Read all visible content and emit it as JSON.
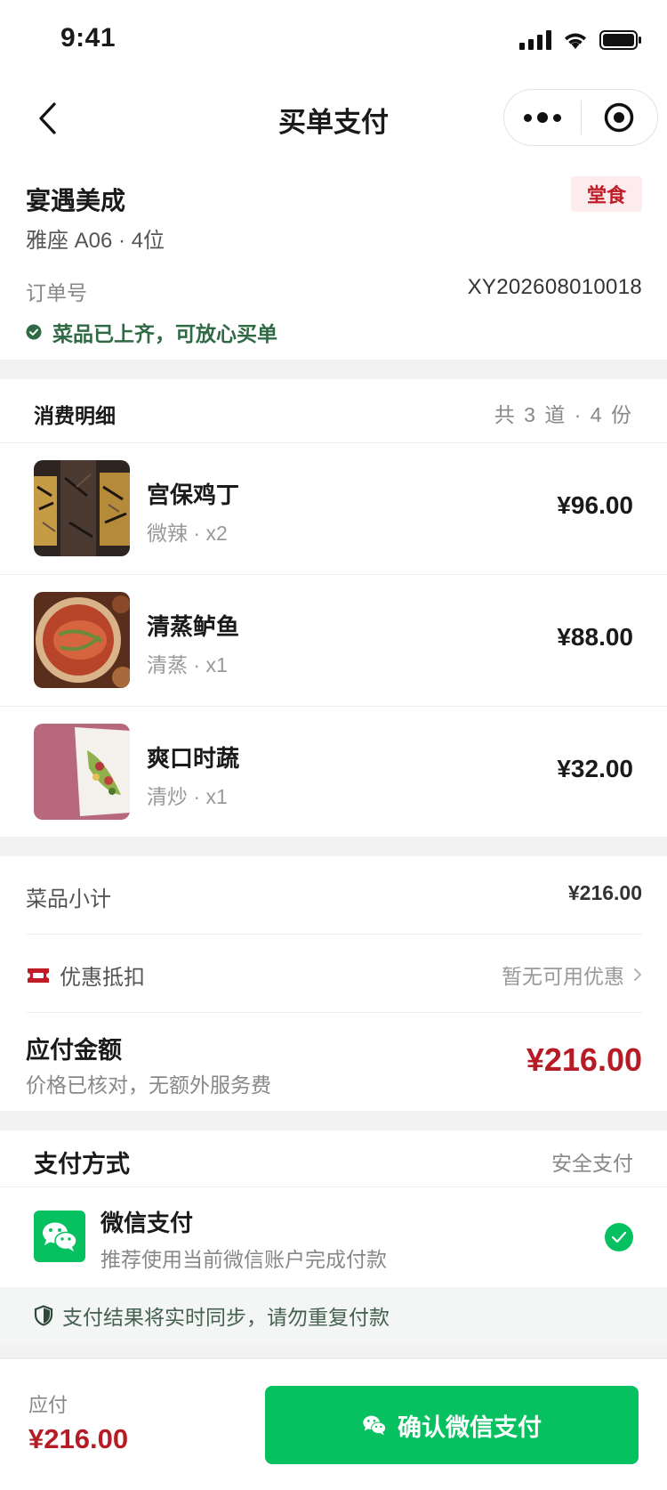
{
  "status_bar": {
    "time": "9:41"
  },
  "nav": {
    "title": "买单支付"
  },
  "store": {
    "name": "宴遇美成",
    "dine_type": "堂食",
    "seat": "雅座 A06 · 4位",
    "order_label": "订单号",
    "order_no": "XY202608010018",
    "ready_text": "菜品已上齐，可放心买单"
  },
  "items": {
    "title": "消费明细",
    "count": "共 3 道 · 4 份",
    "list": [
      {
        "name": "宫保鸡丁",
        "spec": "微辣 · x2",
        "price": "¥96.00",
        "image": "food-photo-gongbao-chicken"
      },
      {
        "name": "清蒸鲈鱼",
        "spec": "清蒸 · x1",
        "price": "¥88.00",
        "image": "food-photo-steamed-fish"
      },
      {
        "name": "爽口时蔬",
        "spec": "清炒 · x1",
        "price": "¥32.00",
        "image": "food-photo-vegetables"
      }
    ]
  },
  "summary": {
    "subtotal_label": "菜品小计",
    "subtotal_value": "¥216.00",
    "coupon_label": "优惠抵扣",
    "coupon_value": "暂无可用优惠",
    "due_label": "应付金额",
    "due_note": "价格已核对，无额外服务费",
    "due_amount": "¥216.00"
  },
  "payment": {
    "title": "支付方式",
    "secure": "安全支付",
    "method_name": "微信支付",
    "method_desc": "推荐使用当前微信账户完成付款",
    "tip": "支付结果将实时同步，请勿重复付款"
  },
  "bottom": {
    "label": "应付",
    "amount": "¥216.00",
    "button": "确认微信支付"
  },
  "colors": {
    "wechat_green": "#07c160",
    "price_red": "#b51c25",
    "ready_green": "#2f6a45"
  }
}
